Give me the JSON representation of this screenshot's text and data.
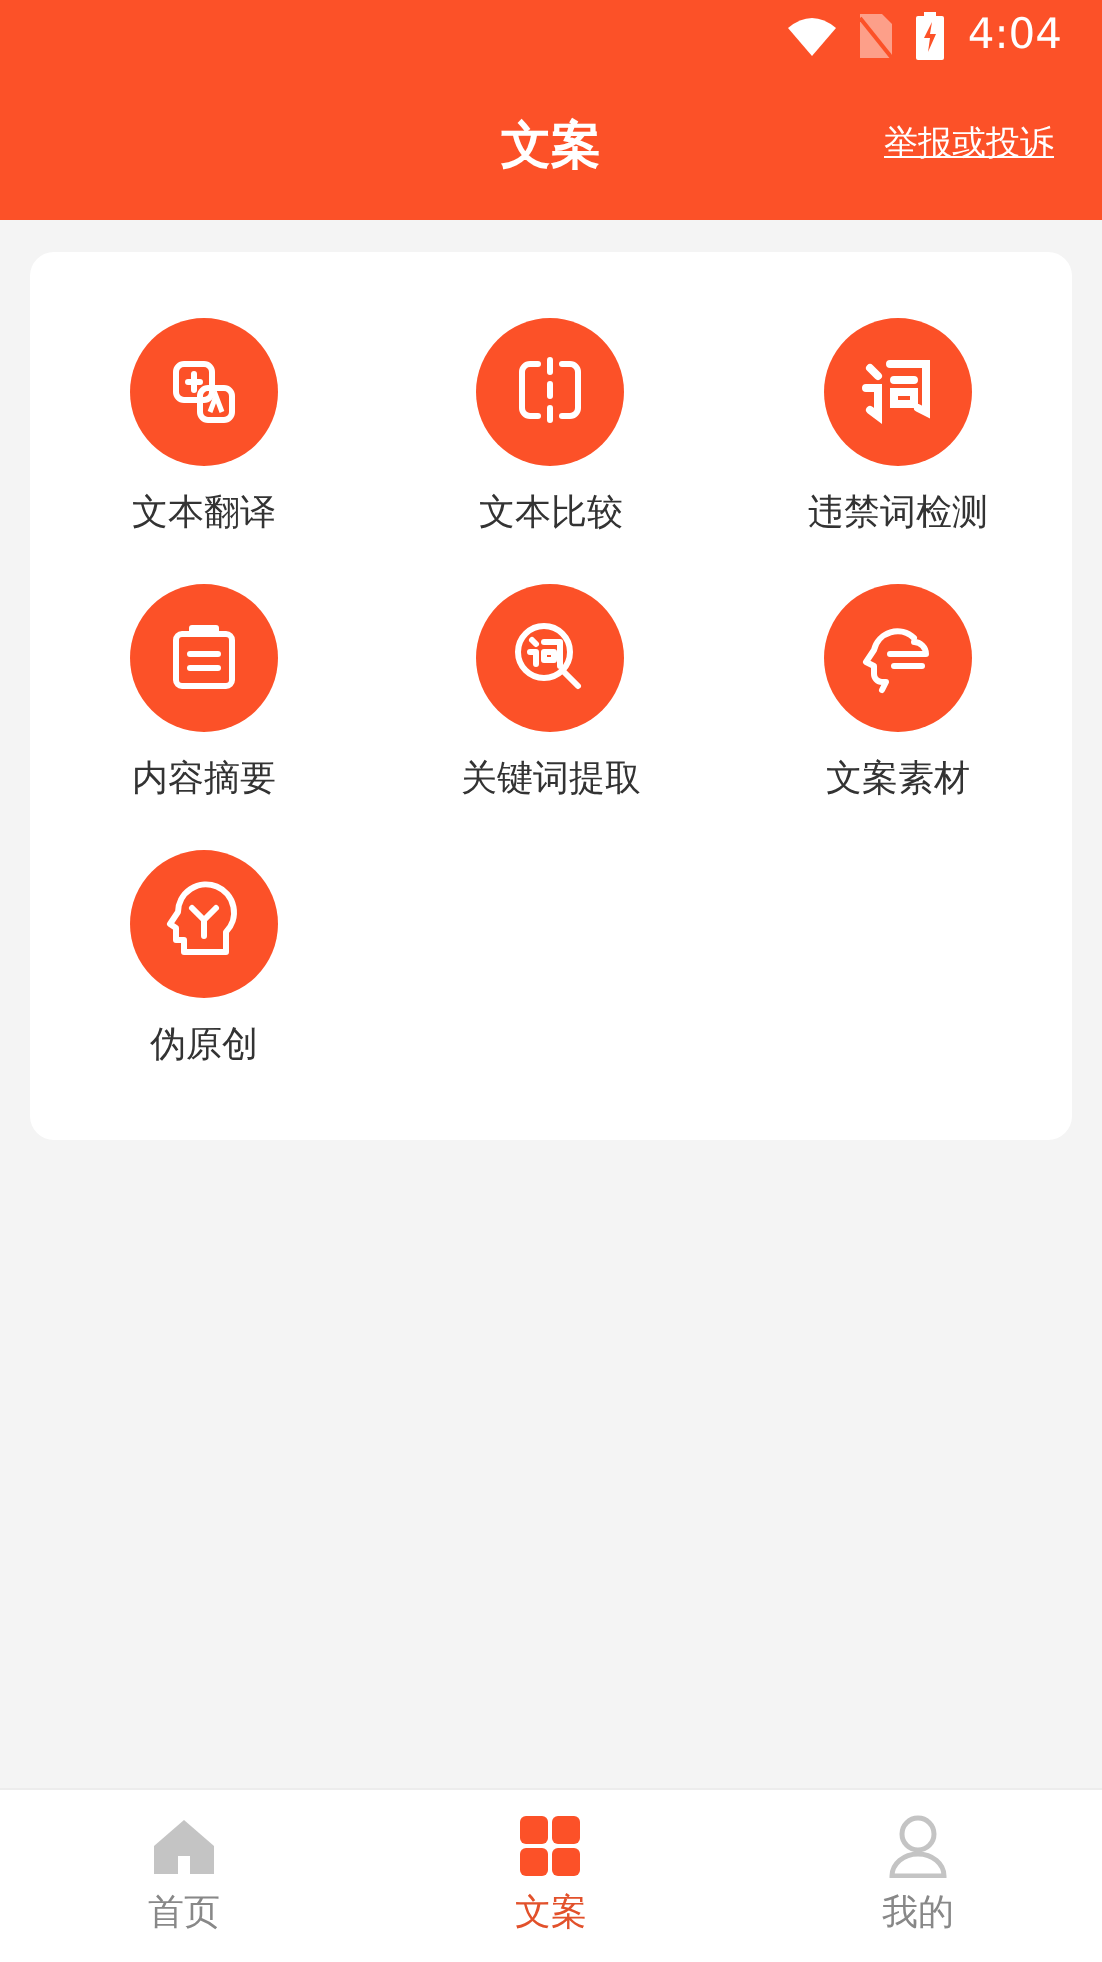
{
  "status_bar": {
    "time": "4:04"
  },
  "header": {
    "title": "文案",
    "link": "举报或投诉"
  },
  "tools": [
    {
      "label": "文本翻译",
      "kind": "translate"
    },
    {
      "label": "文本比较",
      "kind": "compare"
    },
    {
      "label": "违禁词检测",
      "kind": "word"
    },
    {
      "label": "内容摘要",
      "kind": "clipboard"
    },
    {
      "label": "关键词提取",
      "kind": "magnifier"
    },
    {
      "label": "文案素材",
      "kind": "profile"
    },
    {
      "label": "伪原创",
      "kind": "mind"
    }
  ],
  "tabs": [
    {
      "label": "首页",
      "kind": "home",
      "selected": false
    },
    {
      "label": "文案",
      "kind": "grid",
      "selected": true
    },
    {
      "label": "我的",
      "kind": "person",
      "selected": false
    }
  ]
}
